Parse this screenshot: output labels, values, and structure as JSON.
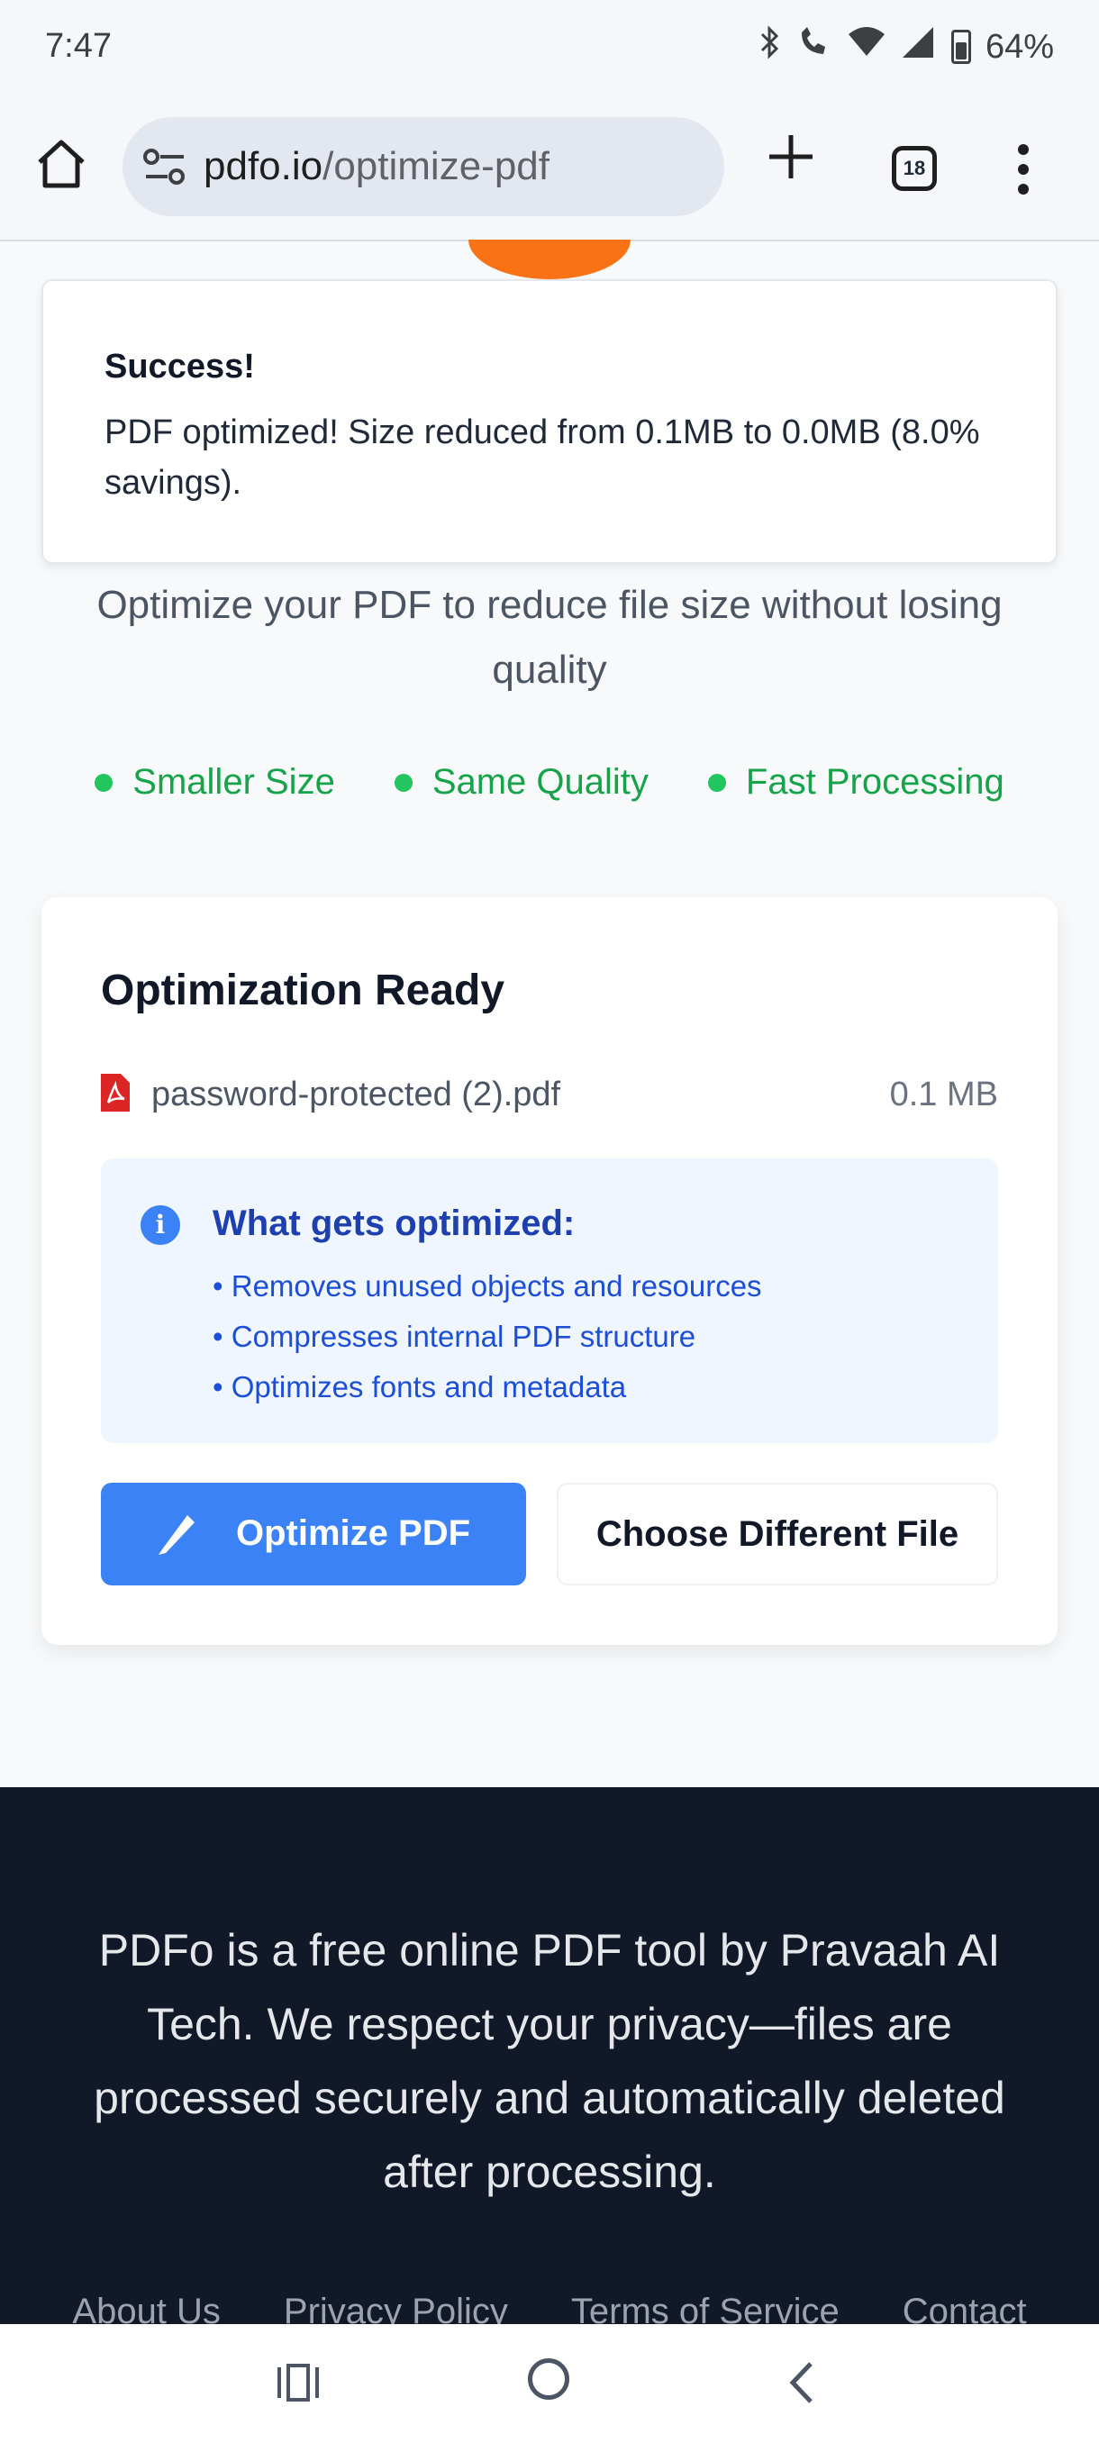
{
  "status_bar": {
    "time": "7:47",
    "battery": "64%"
  },
  "browser": {
    "url_domain": "pdfo.io",
    "url_path": "/optimize-pdf",
    "tab_count": "18"
  },
  "toast": {
    "title": "Success!",
    "message": "PDF optimized! Size reduced from 0.1MB to 0.0MB (8.0% savings)."
  },
  "page": {
    "subtitle": "Optimize your PDF to reduce file size without losing quality",
    "features": [
      "Smaller Size",
      "Same Quality",
      "Fast Processing"
    ]
  },
  "card": {
    "title": "Optimization Ready",
    "file_name": "password-protected (2).pdf",
    "file_size": "0.1 MB",
    "info_title": "What gets optimized:",
    "info_items": [
      "Removes unused objects and resources",
      "Compresses internal PDF structure",
      "Optimizes fonts and metadata"
    ],
    "primary_button": "Optimize PDF",
    "secondary_button": "Choose Different File"
  },
  "footer": {
    "text": "PDFo is a free online PDF tool by Pravaah AI Tech. We respect your privacy—files are processed securely and automatically deleted after processing.",
    "links": [
      "About Us",
      "Privacy Policy",
      "Terms of Service",
      "Contact"
    ]
  },
  "colors": {
    "accent": "#3b82f6",
    "success": "#16a34a",
    "orange": "#f97316",
    "footer_bg": "#111827"
  }
}
